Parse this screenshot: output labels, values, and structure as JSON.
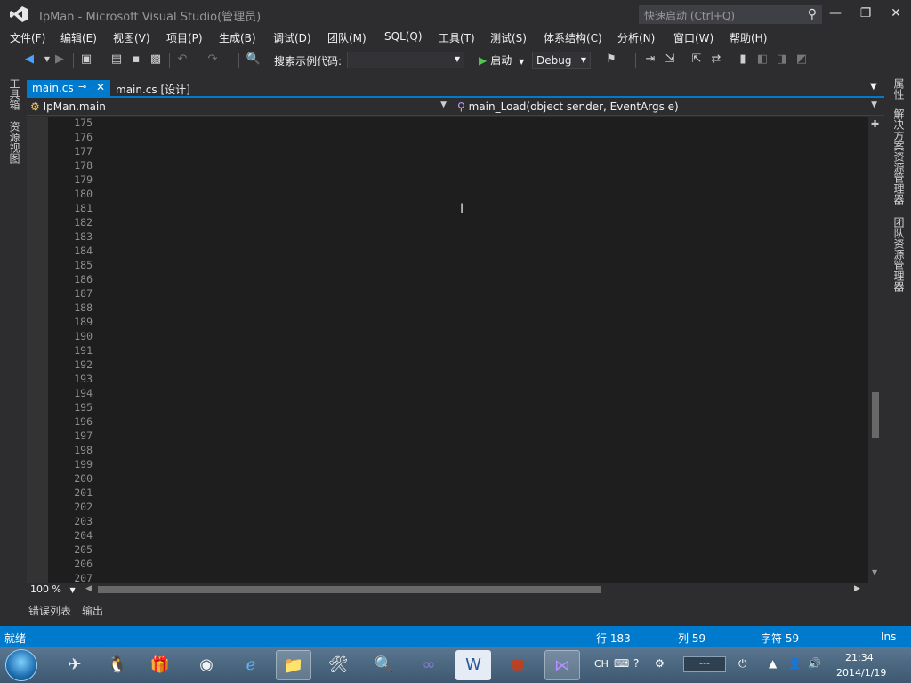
{
  "window": {
    "title": "IpMan - Microsoft Visual Studio(管理员)",
    "quick_launch_placeholder": "快速启动 (Ctrl+Q)",
    "minimize": "—",
    "restore": "❐",
    "close": "✕"
  },
  "menu": [
    "文件(F)",
    "编辑(E)",
    "视图(V)",
    "项目(P)",
    "生成(B)",
    "调试(D)",
    "团队(M)",
    "SQL(Q)",
    "工具(T)",
    "测试(S)",
    "体系结构(C)",
    "分析(N)",
    "窗口(W)",
    "帮助(H)"
  ],
  "toolbar": {
    "search_label": "搜索示例代码:",
    "search_value": "",
    "start_label": "启动",
    "config_value": "Debug"
  },
  "left_tabs": [
    "工具箱",
    "资源视图"
  ],
  "right_tabs": [
    "属性",
    "解决方案资源管理器",
    "团队资源管理器"
  ],
  "tabs": {
    "active": "main.cs",
    "design": "main.cs [设计]"
  },
  "nav": {
    "class_combo": "IpMan.main",
    "member_combo": "main_Load(object sender, EventArgs e)"
  },
  "editor": {
    "line_numbers": [
      "175",
      "176",
      "177",
      "178",
      "179",
      "180",
      "181",
      "182",
      "183",
      "184",
      "185",
      "186",
      "187",
      "188",
      "189",
      "190",
      "191",
      "192",
      "193",
      "194",
      "195",
      "196",
      "197",
      "198",
      "199",
      "200",
      "201",
      "202",
      "203",
      "204",
      "205",
      "206",
      "207"
    ]
  },
  "bottom_tabs": [
    "错误列表",
    "输出"
  ],
  "zoom": "100 %",
  "status": {
    "state": "就绪",
    "line": "行 183",
    "col": "列 59",
    "ch": "字符 59",
    "mode": "Ins"
  },
  "tray": {
    "lang": "CH",
    "time": "21:34",
    "date": "2014/1/19"
  },
  "colors": {
    "accent": "#007acc",
    "editor_bg": "#1e1e1e",
    "keyword": "#569cd6",
    "string": "#d69d85",
    "comment": "#57a64a"
  }
}
